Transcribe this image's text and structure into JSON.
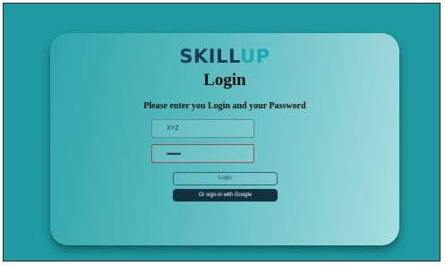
{
  "brand": {
    "logo_part1": "SKILL",
    "logo_part2": "UP"
  },
  "login_form": {
    "title": "Login",
    "subtitle": "Please enter you Login and your Password",
    "login_value": "XYZ",
    "password_value": "•••••••",
    "login_button": "Login",
    "google_button": "Or sign-in with Google"
  },
  "colors": {
    "background": "#1f9aa0",
    "logo_dark": "#1c3a5e",
    "logo_accent": "#17a9b3",
    "google_button": "#14323d"
  }
}
